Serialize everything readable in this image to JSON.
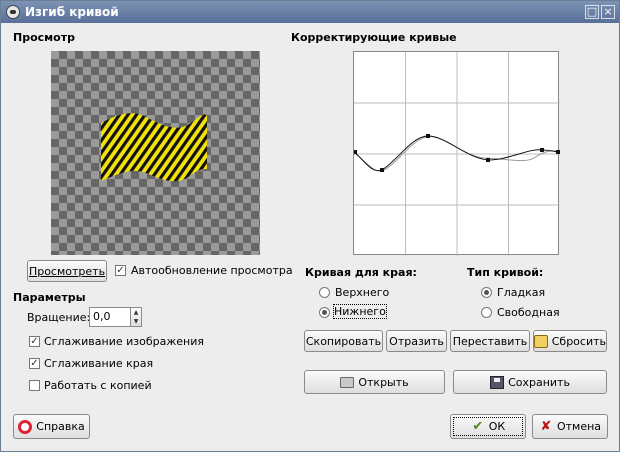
{
  "window": {
    "title": "Изгиб кривой",
    "maximize_glyph": "□",
    "close_glyph": "×"
  },
  "preview": {
    "section_title": "Просмотр",
    "preview_button": "Просмотреть",
    "auto_update_label": "Автообновление просмотра",
    "auto_update_checked": true
  },
  "params": {
    "section_title": "Параметры",
    "rotation_label": "Вращение:",
    "rotation_value": "0,0",
    "antialias_label": "Сглаживание изображения",
    "antialias_checked": true,
    "smooth_edges_label": "Сглаживание края",
    "smooth_edges_checked": true,
    "work_on_copy_label": "Работать с копией",
    "work_on_copy_checked": false
  },
  "curves": {
    "section_title": "Корректирующие кривые",
    "edge_title": "Кривая для края:",
    "edge_upper": "Верхнего",
    "edge_lower": "Нижнего",
    "edge_selected": "lower",
    "type_title": "Тип кривой:",
    "type_smooth": "Гладкая",
    "type_free": "Свободная",
    "type_selected": "smooth",
    "copy_button": "Скопировать",
    "mirror_button": "Отразить",
    "swap_button": "Переставить",
    "reset_button": "Сбросить",
    "open_button": "Открыть",
    "save_button": "Сохранить"
  },
  "footer": {
    "help_button": "Справка",
    "ok_button": "ОК",
    "cancel_button": "Отмена"
  },
  "colors": {
    "titlebar": "#58709a",
    "stripe_yellow": "#f2e20a",
    "stripe_black": "#111111"
  },
  "icons": {
    "app": "gimp-icon",
    "help": "lifebuoy-icon",
    "open": "folder-icon",
    "save": "floppy-icon",
    "reset": "reset-icon",
    "ok": "check-icon",
    "cancel": "x-icon"
  }
}
